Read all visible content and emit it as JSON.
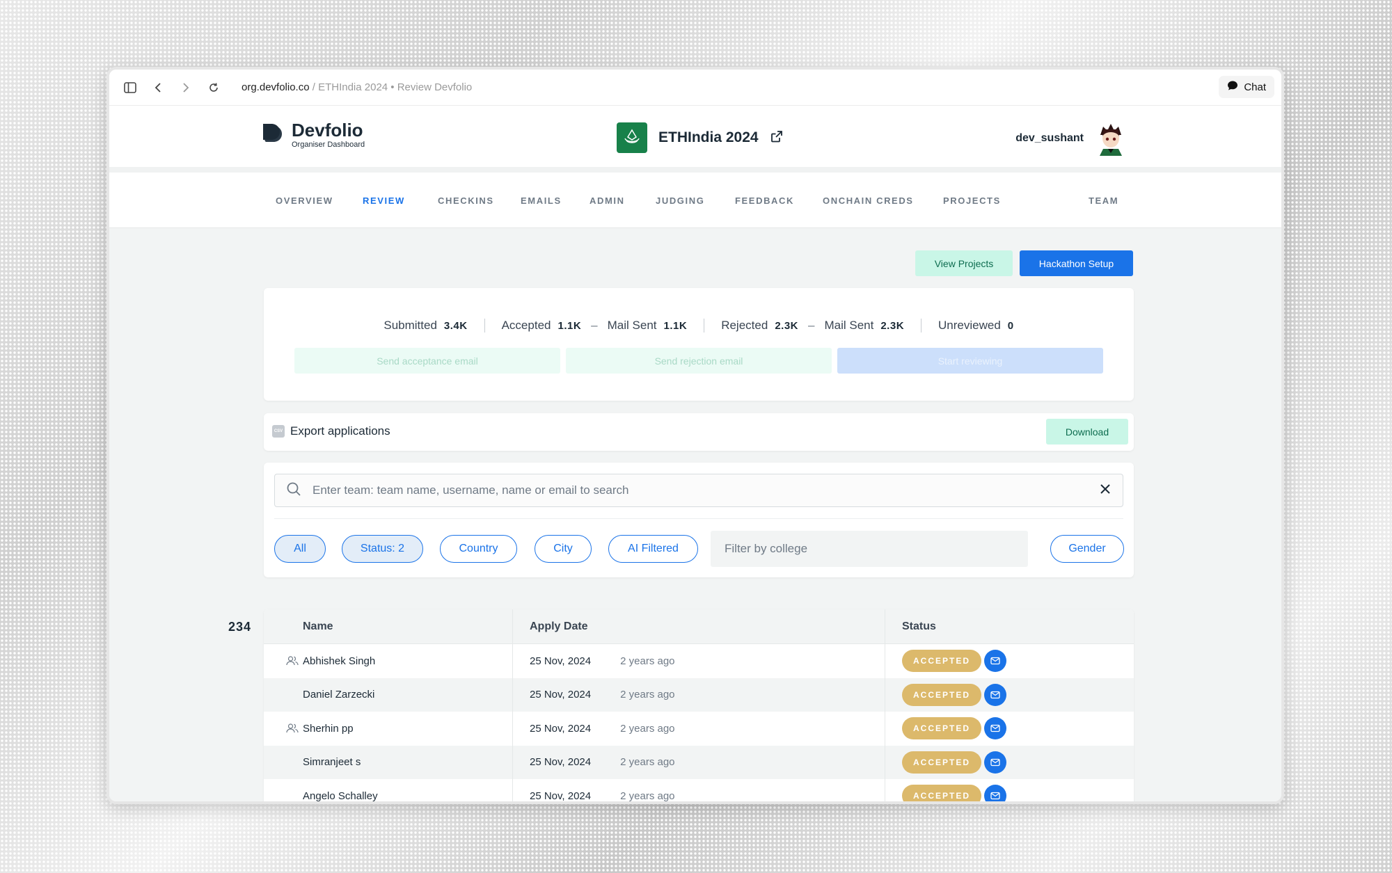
{
  "browser": {
    "url_domain": "org.devfolio.co",
    "url_path": " / ETHIndia 2024 • Review Devfolio",
    "chat_label": "Chat"
  },
  "header": {
    "brand_name": "Devfolio",
    "brand_sub": "Organiser Dashboard",
    "event_name": "ETHIndia 2024",
    "username": "dev_sushant"
  },
  "tabs": [
    {
      "label": "OVERVIEW"
    },
    {
      "label": "REVIEW",
      "active": true
    },
    {
      "label": "CHECKINS"
    },
    {
      "label": "EMAILS"
    },
    {
      "label": "ADMIN"
    },
    {
      "label": "JUDGING"
    },
    {
      "label": "FEEDBACK"
    },
    {
      "label": "ONCHAIN CREDS"
    },
    {
      "label": "PROJECTS"
    },
    {
      "label": "TEAM"
    }
  ],
  "actions": {
    "view_projects": "View Projects",
    "hackathon_setup": "Hackathon Setup"
  },
  "stats": {
    "submitted_label": "Submitted",
    "submitted_value": "3.4K",
    "accepted_label": "Accepted",
    "accepted_value": "1.1K",
    "accepted_mail_label": "Mail Sent",
    "accepted_mail_value": "1.1K",
    "rejected_label": "Rejected",
    "rejected_value": "2.3K",
    "rejected_mail_label": "Mail Sent",
    "rejected_mail_value": "2.3K",
    "unreviewed_label": "Unreviewed",
    "unreviewed_value": "0",
    "dash": "–",
    "send_acceptance": "Send acceptance email",
    "send_rejection": "Send rejection email",
    "start_reviewing": "Start reviewing"
  },
  "export": {
    "csv_icon_text": "CSV",
    "label": "Export applications",
    "download": "Download"
  },
  "search": {
    "placeholder": "Enter team: team name, username, name or email to search"
  },
  "filters": {
    "all": "All",
    "status": "Status: 2",
    "country": "Country",
    "city": "City",
    "ai_filtered": "AI Filtered",
    "college_placeholder": "Filter by college",
    "gender": "Gender"
  },
  "table": {
    "count": "234",
    "headers": {
      "name": "Name",
      "apply_date": "Apply Date",
      "status": "Status"
    },
    "rows": [
      {
        "name": "Abhishek Singh",
        "date": "25 Nov, 2024",
        "ago": "2 years ago",
        "status": "ACCEPTED",
        "team": true
      },
      {
        "name": "Daniel Zarzecki",
        "date": "25 Nov, 2024",
        "ago": "2 years ago",
        "status": "ACCEPTED",
        "team": false
      },
      {
        "name": "Sherhin pp",
        "date": "25 Nov, 2024",
        "ago": "2 years ago",
        "status": "ACCEPTED",
        "team": true
      },
      {
        "name": "Simranjeet s",
        "date": "25 Nov, 2024",
        "ago": "2 years ago",
        "status": "ACCEPTED",
        "team": false
      },
      {
        "name": "Angelo Schalley",
        "date": "25 Nov, 2024",
        "ago": "2 years ago",
        "status": "ACCEPTED",
        "team": false
      }
    ]
  },
  "colors": {
    "accent": "#1a73e8",
    "accepted_badge": "#dcb96b",
    "event_logo": "#18814a",
    "mint_button": "#c9f6e7"
  }
}
